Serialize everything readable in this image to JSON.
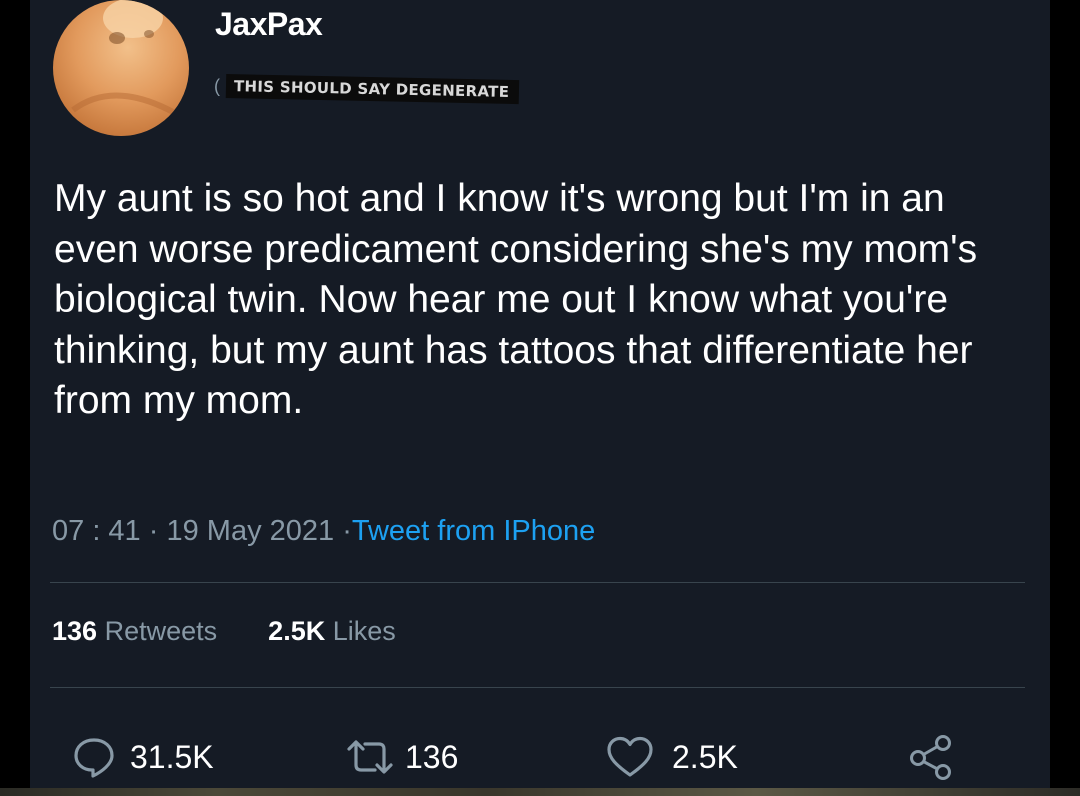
{
  "author": {
    "display_name": "JaxPax",
    "handle_open_paren": "(",
    "handle_censor_label": "THIS SHOULD SAY DEGENERATE"
  },
  "tweet": {
    "text": "My aunt is so hot and I know it's wrong but I'm in an even worse predicament considering she's my mom's biological twin. Now hear me out I know what you're thinking, but my aunt has tattoos that differentiate her from my mom.",
    "time": "07 : 41",
    "separator": " · ",
    "date": "19 May 2021",
    "source_separator": " ·",
    "source": "Tweet from IPhone"
  },
  "stats": {
    "retweets_count": "136",
    "retweets_label": "Retweets",
    "likes_count": "2.5K",
    "likes_label": "Likes"
  },
  "actions": {
    "reply_count": "31.5K",
    "retweet_count": "136",
    "like_count": "2.5K"
  },
  "colors": {
    "background": "#151b25",
    "text_primary": "#ffffff",
    "text_secondary": "#8899a6",
    "link": "#1da1f2",
    "divider": "#38444d"
  },
  "icons": [
    "reply-icon",
    "retweet-icon",
    "heart-icon",
    "share-icon"
  ]
}
